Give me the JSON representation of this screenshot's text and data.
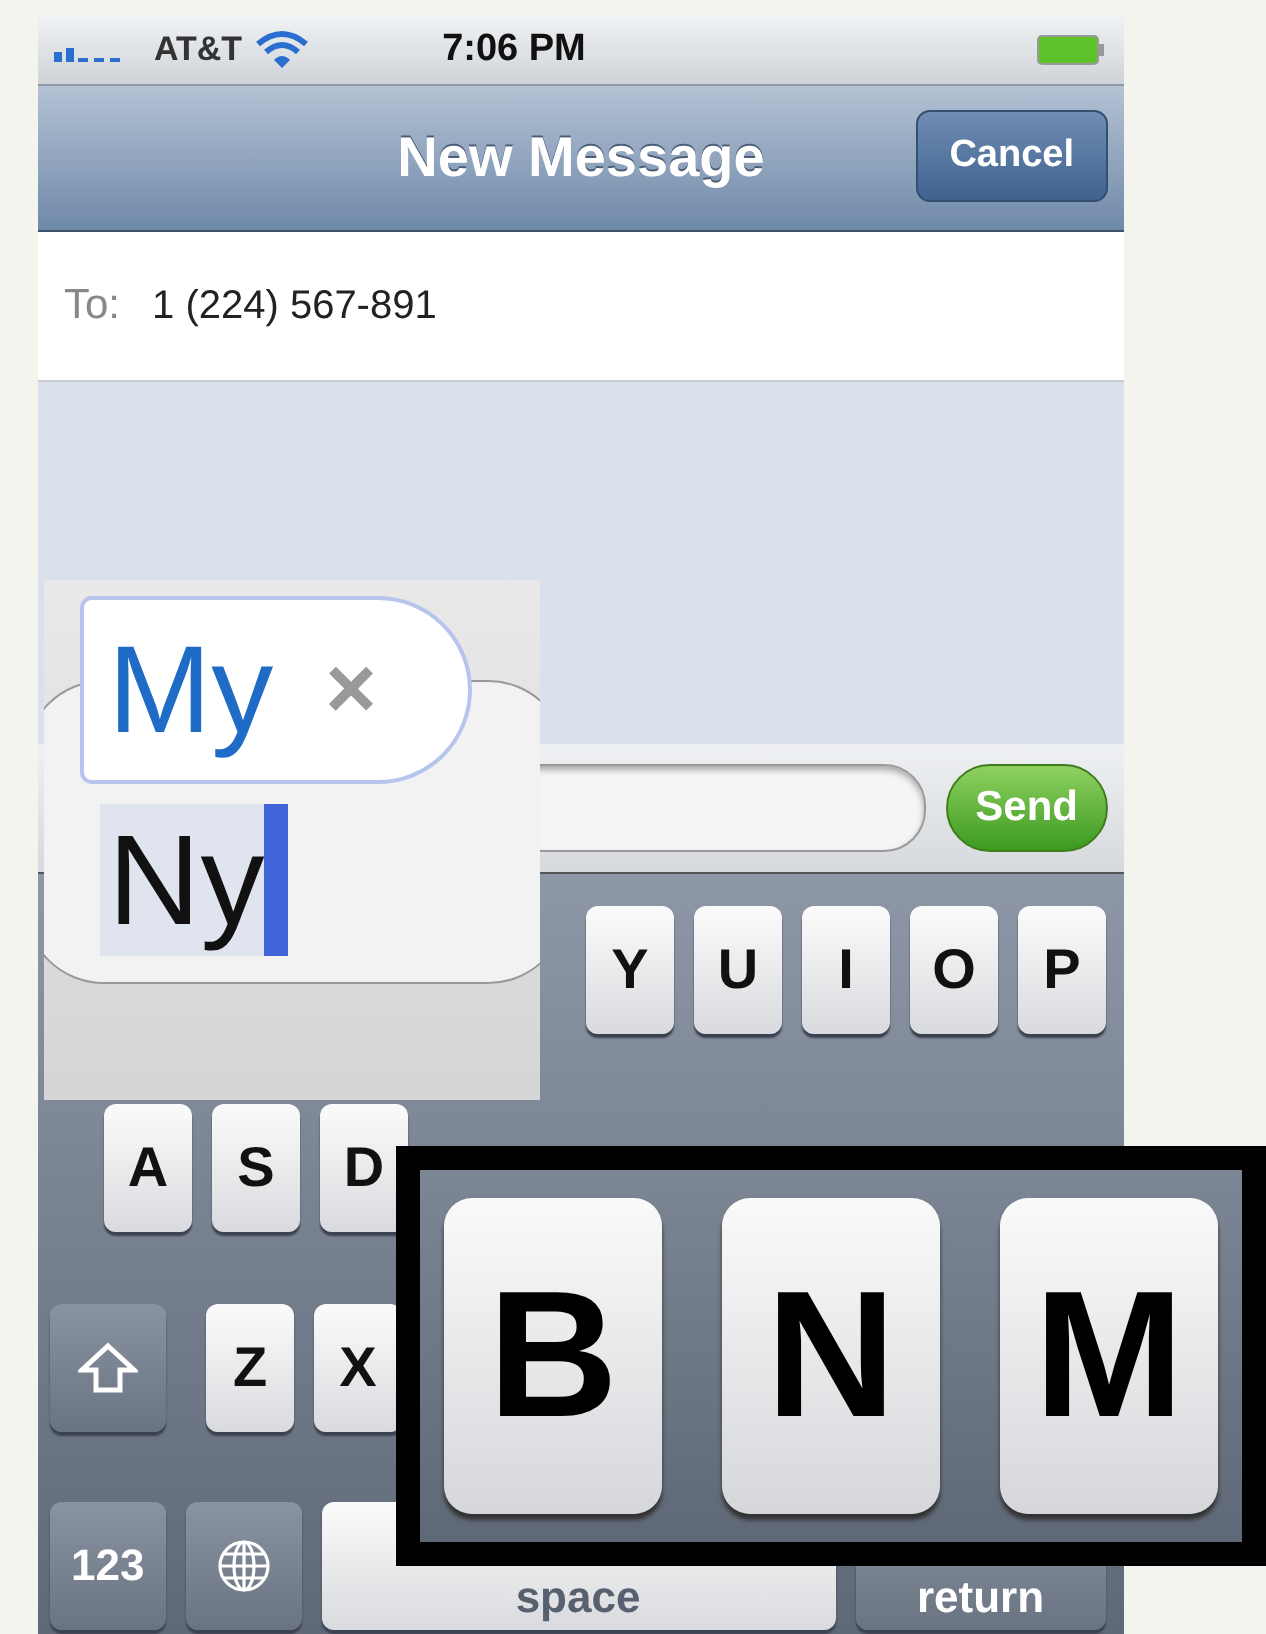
{
  "status_bar": {
    "carrier": "AT&T",
    "time": "7:06 PM"
  },
  "nav_bar": {
    "title": "New Message",
    "right_button": "Cancel"
  },
  "to_field": {
    "label": "To:",
    "value": "1 (224) 567-891"
  },
  "input_bar": {
    "send_button": "Send"
  },
  "keyboard": {
    "rows": [
      [
        {
          "kind": "letter",
          "label": "Y"
        },
        {
          "kind": "letter",
          "label": "U"
        },
        {
          "kind": "letter",
          "label": "I"
        },
        {
          "kind": "letter",
          "label": "O"
        },
        {
          "kind": "letter",
          "label": "P"
        }
      ],
      [
        {
          "kind": "letter",
          "label": "A"
        },
        {
          "kind": "letter",
          "label": "S"
        },
        {
          "kind": "letter",
          "label": "D"
        }
      ],
      [
        {
          "kind": "shift"
        },
        {
          "kind": "letter",
          "label": "Z"
        },
        {
          "kind": "letter",
          "label": "X"
        }
      ],
      [
        {
          "kind": "numbers",
          "label": "123"
        },
        {
          "kind": "globe"
        },
        {
          "kind": "space",
          "label": "space"
        },
        {
          "kind": "return",
          "label": "return"
        }
      ]
    ]
  },
  "magnified_autocorrect": {
    "suggestion": "My",
    "dismiss": "×",
    "typed": "Ny"
  },
  "magnified_keys": [
    "B",
    "N",
    "M"
  ]
}
